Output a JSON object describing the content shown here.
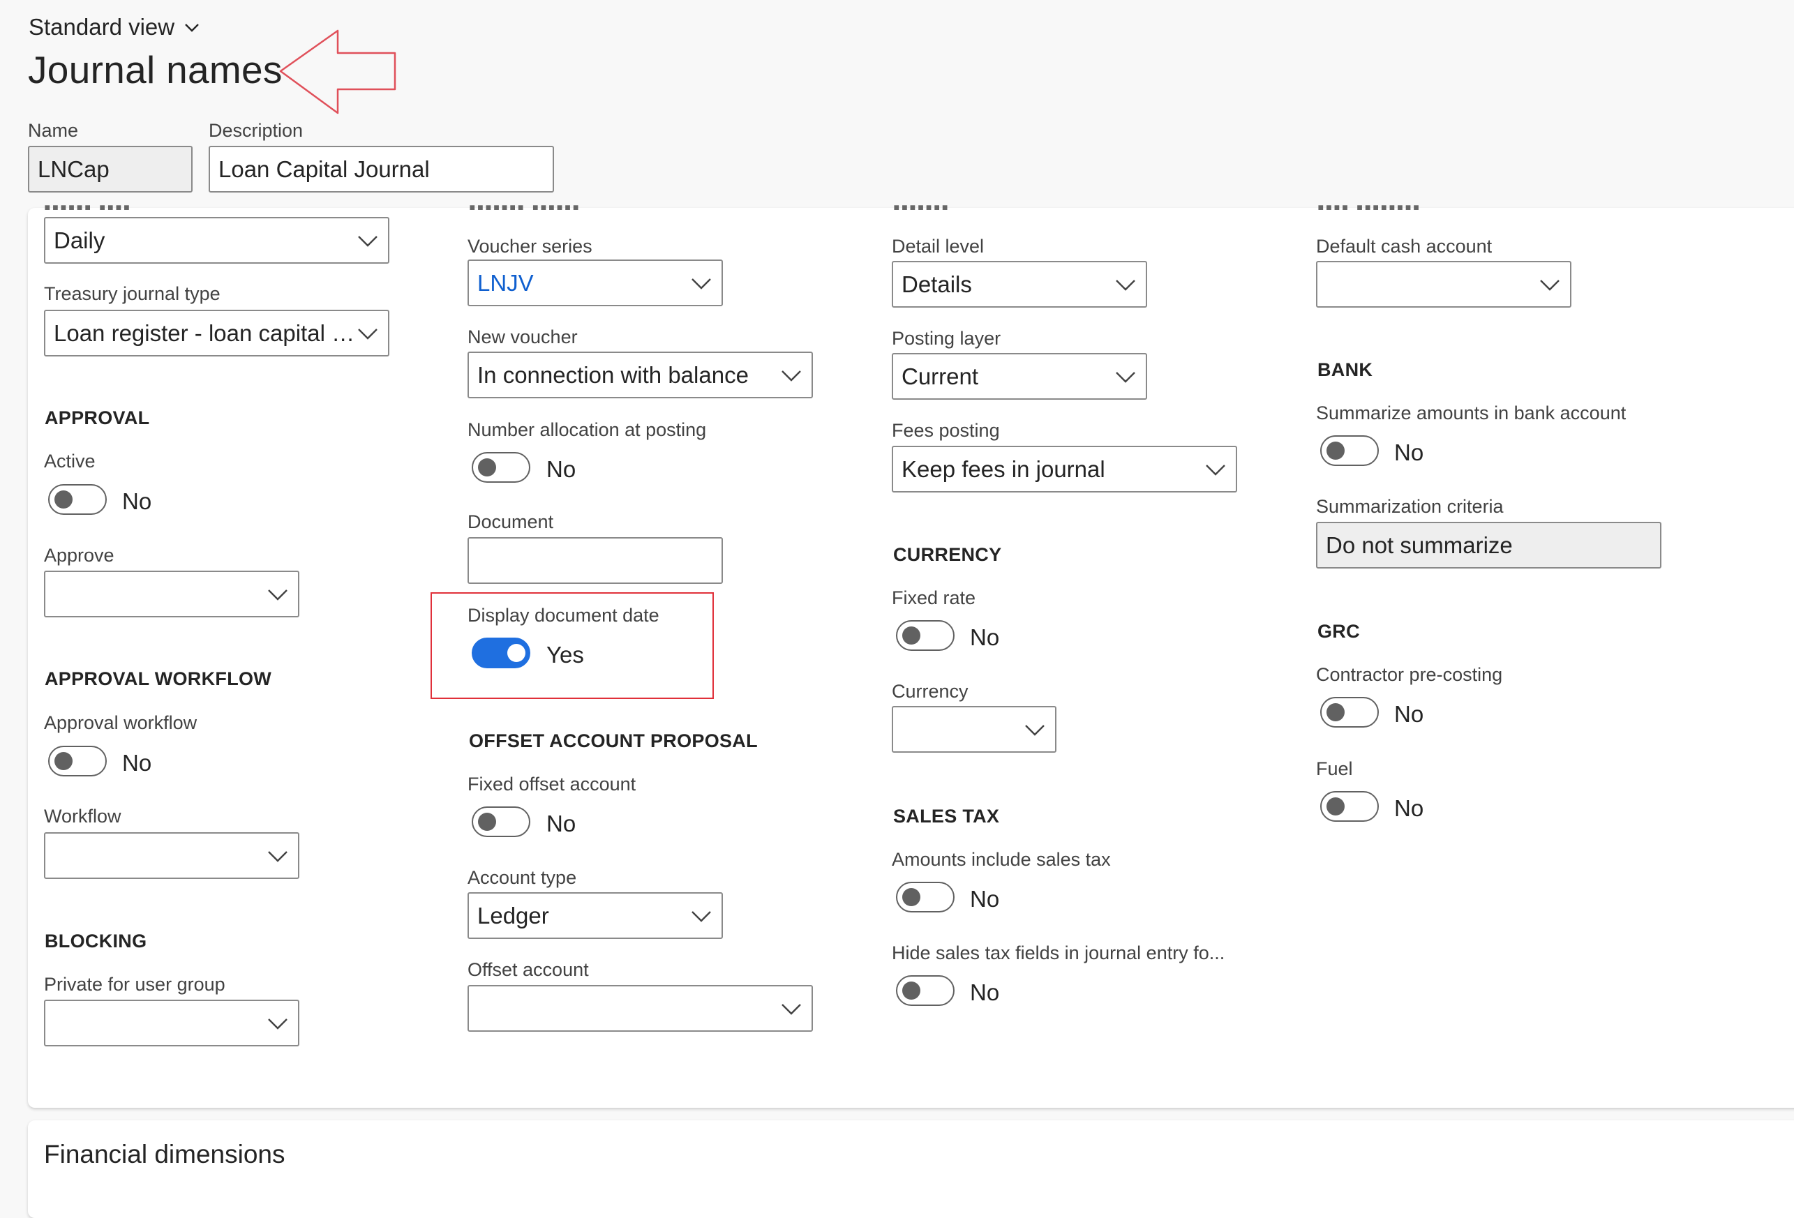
{
  "header": {
    "view_label": "Standard view",
    "title": "Journal names",
    "name_label": "Name",
    "name_value": "LNCap",
    "description_label": "Description",
    "description_value": "Loan Capital Journal"
  },
  "col1": {
    "journal_type_value": "Daily",
    "treasury_label": "Treasury journal type",
    "treasury_value": "Loan register - loan capital tr...",
    "approval_heading": "APPROVAL",
    "active_label": "Active",
    "active_value": "No",
    "approve_label": "Approve",
    "approve_value": "",
    "workflow_heading": "APPROVAL WORKFLOW",
    "approval_workflow_label": "Approval workflow",
    "approval_workflow_value": "No",
    "workflow_label": "Workflow",
    "workflow_value": "",
    "blocking_heading": "BLOCKING",
    "private_label": "Private for user group",
    "private_value": ""
  },
  "col2": {
    "voucher_series_label": "Voucher series",
    "voucher_series_value": "LNJV",
    "new_voucher_label": "New voucher",
    "new_voucher_value": "In connection with balance",
    "number_alloc_label": "Number allocation at posting",
    "number_alloc_value": "No",
    "document_label": "Document",
    "document_value": "",
    "display_doc_date_label": "Display document date",
    "display_doc_date_value": "Yes",
    "offset_heading": "OFFSET ACCOUNT PROPOSAL",
    "fixed_offset_label": "Fixed offset account",
    "fixed_offset_value": "No",
    "account_type_label": "Account type",
    "account_type_value": "Ledger",
    "offset_account_label": "Offset account",
    "offset_account_value": ""
  },
  "col3": {
    "detail_level_label": "Detail level",
    "detail_level_value": "Details",
    "posting_layer_label": "Posting layer",
    "posting_layer_value": "Current",
    "fees_posting_label": "Fees posting",
    "fees_posting_value": "Keep fees in journal",
    "currency_heading": "CURRENCY",
    "fixed_rate_label": "Fixed rate",
    "fixed_rate_value": "No",
    "currency_label": "Currency",
    "currency_value": "",
    "sales_tax_heading": "SALES TAX",
    "amounts_incl_label": "Amounts include sales tax",
    "amounts_incl_value": "No",
    "hide_tax_label": "Hide sales tax fields in journal entry fo...",
    "hide_tax_value": "No"
  },
  "col4": {
    "default_cash_label": "Default cash account",
    "default_cash_value": "",
    "bank_heading": "BANK",
    "summarize_label": "Summarize amounts in bank account",
    "summarize_value": "No",
    "criteria_label": "Summarization criteria",
    "criteria_value": "Do not summarize",
    "grc_heading": "GRC",
    "contractor_label": "Contractor pre-costing",
    "contractor_value": "No",
    "fuel_label": "Fuel",
    "fuel_value": "No"
  },
  "footer": {
    "financial_dimensions": "Financial dimensions"
  },
  "colors": {
    "accent": "#1f6fe0",
    "link": "#0f5fcf",
    "annotation": "#e0303a"
  }
}
